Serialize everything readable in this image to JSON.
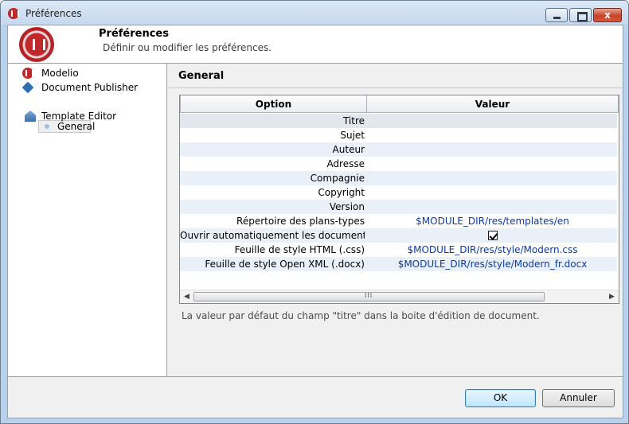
{
  "window": {
    "title": "Préférences",
    "controls": {
      "minimize": "",
      "maximize": "",
      "close": "x"
    }
  },
  "banner": {
    "title": "Préférences",
    "subtitle": "Définir ou modifier les préférences."
  },
  "tree": {
    "items": [
      {
        "label": "Modelio",
        "icon": "modelio-icon"
      },
      {
        "label": "Document Publisher",
        "icon": "document-publisher-icon"
      },
      {
        "label": "General",
        "icon": "bullet-icon",
        "selected": true
      },
      {
        "label": "Template Editor",
        "icon": "template-editor-icon"
      }
    ]
  },
  "page": {
    "title": "General",
    "description": "La valeur par défaut du champ \"titre\" dans la boite d'édition de document."
  },
  "table": {
    "headers": {
      "option": "Option",
      "value": "Valeur"
    },
    "rows": [
      {
        "option": "Titre",
        "value": ""
      },
      {
        "option": "Sujet",
        "value": ""
      },
      {
        "option": "Auteur",
        "value": ""
      },
      {
        "option": "Adresse",
        "value": ""
      },
      {
        "option": "Compagnie",
        "value": ""
      },
      {
        "option": "Copyright",
        "value": ""
      },
      {
        "option": "Version",
        "value": ""
      },
      {
        "option": "Répertoire des plans-types",
        "value": "$MODULE_DIR/res/templates/en"
      },
      {
        "option": "Ouvrir automatiquement les documents ...",
        "value": "",
        "checkbox": true
      },
      {
        "option": "Feuille de style HTML (.css)",
        "value": "$MODULE_DIR/res/style/Modern.css"
      },
      {
        "option": "Feuille de style Open XML (.docx)",
        "value": "$MODULE_DIR/res/style/Modern_fr.docx"
      }
    ],
    "scroll": {
      "left": "◀",
      "right": "▶",
      "grip": "III"
    }
  },
  "buttons": {
    "ok": "OK",
    "cancel": "Annuler"
  },
  "colors": {
    "link_value": "#0a3aa8",
    "ok_border": "#3c7fb1",
    "brand": "#c0282c"
  }
}
